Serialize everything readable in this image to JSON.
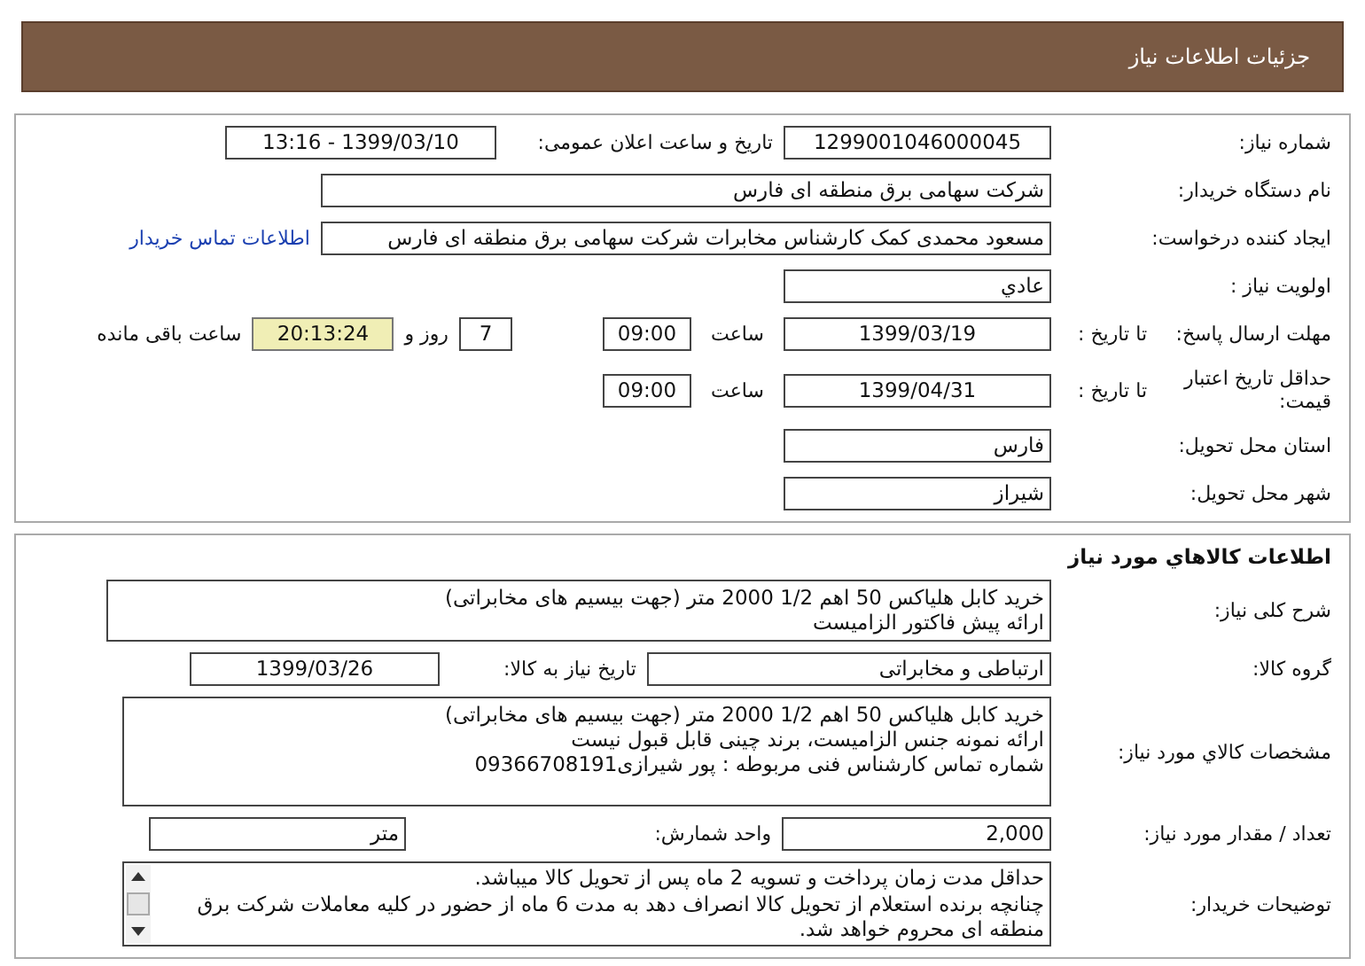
{
  "header": {
    "title": "جزئیات اطلاعات نیاز"
  },
  "general": {
    "need_number": {
      "label": "شماره نیاز:",
      "value": "1299001046000045"
    },
    "announce": {
      "label": "تاریخ و ساعت اعلان عمومی:",
      "value": "1399/03/10 - 13:16"
    },
    "buyer_org": {
      "label": "نام دستگاه خریدار:",
      "value": "شرکت سهامی برق منطقه ای فارس"
    },
    "requester": {
      "label": "ایجاد کننده درخواست:",
      "value": "مسعود محمدی کمک کارشناس مخابرات شرکت سهامی برق منطقه ای فارس",
      "link": "اطلاعات تماس خریدار"
    },
    "priority": {
      "label": "اولویت نیاز :",
      "value": "عادي"
    },
    "reply_deadline": {
      "label": "مهلت ارسال پاسخ:",
      "to_label": "تا تاریخ :",
      "date": "1399/03/19",
      "time_label": "ساعت",
      "time": "09:00",
      "days": "7",
      "days_label": "روز و",
      "remaining": "20:13:24",
      "remaining_label": "ساعت باقی مانده"
    },
    "price_validity": {
      "label": "حداقل تاریخ اعتبار قیمت:",
      "to_label": "تا تاریخ :",
      "date": "1399/04/31",
      "time_label": "ساعت",
      "time": "09:00"
    },
    "province": {
      "label": "استان محل تحویل:",
      "value": "فارس"
    },
    "city": {
      "label": "شهر محل تحویل:",
      "value": "شیراز"
    }
  },
  "goods": {
    "title": "اطلاعات کالاهاي مورد نياز",
    "description": {
      "label": "شرح کلی نیاز:",
      "lines": [
        "خرید کابل هلیاکس 50 اهم 1/2  2000 متر (جهت بیسیم های مخابراتی)",
        "ارائه پیش فاکتور الزامیست"
      ]
    },
    "group": {
      "label": "گروه کالا:",
      "value": "ارتباطی و مخابراتی"
    },
    "need_date": {
      "label": "تاریخ نیاز به کالا:",
      "value": "1399/03/26"
    },
    "specs": {
      "label": "مشخصات کالاي مورد نياز:",
      "lines": [
        "خرید کابل هلیاکس 50 اهم 1/2  2000 متر (جهت بیسیم های مخابراتی)",
        "ارائه نمونه جنس الزامیست، برند چینی قابل قبول نیست",
        "شماره تماس کارشناس فنی مربوطه :  پور شیرازی09366708191"
      ]
    },
    "quantity": {
      "label": "تعداد / مقدار مورد نیاز:",
      "value": "2,000"
    },
    "unit": {
      "label": "واحد شمارش:",
      "value": "متر"
    },
    "buyer_notes": {
      "label": "توضیحات خریدار:",
      "lines": [
        "حداقل مدت زمان پرداخت و تسویه 2 ماه پس از تحویل کالا میباشد.",
        "چنانچه برنده استعلام از تحویل کالا انصراف دهد به مدت 6 ماه از حضور در کلیه معاملات شرکت برق",
        "منطقه ای محروم خواهد شد."
      ]
    }
  }
}
